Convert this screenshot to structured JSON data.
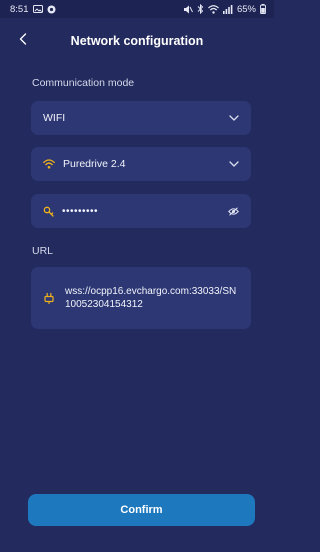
{
  "status_bar": {
    "time": "8:51",
    "battery": "65%",
    "icons": [
      "gallery-icon",
      "chat-icon",
      "mute-icon",
      "bluetooth-icon",
      "wifi-icon",
      "signal-icon",
      "battery-icon"
    ]
  },
  "header": {
    "title": "Network configuration",
    "back_icon": "back-icon"
  },
  "form": {
    "communication_mode_label": "Communication mode",
    "mode_value": "WIFI",
    "network_value": "Puredrive 2.4",
    "password_value": "•••••••••",
    "url_label": "URL",
    "url_value": "wss://ocpp16.evchargo.com:33033/SN10052304154312"
  },
  "actions": {
    "confirm_label": "Confirm"
  },
  "colors": {
    "background": "#232a5e",
    "field": "#2d3774",
    "accent": "#f0b21a",
    "button": "#1e78be"
  }
}
